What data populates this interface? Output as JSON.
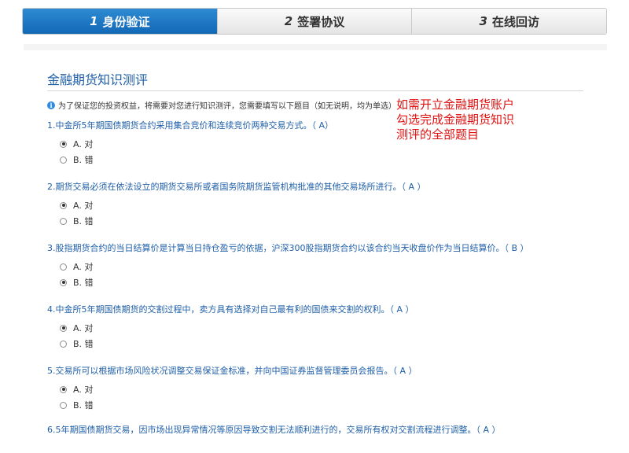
{
  "steps": [
    {
      "num": "1",
      "label": "身份验证",
      "active": true
    },
    {
      "num": "2",
      "label": "签署协议",
      "active": false
    },
    {
      "num": "3",
      "label": "在线回访",
      "active": false
    }
  ],
  "section_title": "金融期货知识测评",
  "notice": "为了保证您的投资权益，将需要对您进行知识测评，您需要填写以下题目（如无说明，均为单选）",
  "callout": [
    "如需开立金融期货账户",
    "勾选完成金融期货知识",
    "测评的全部题目"
  ],
  "questions": [
    {
      "text": "1.中金所5年期国债期货合约采用集合竞价和连续竞价两种交易方式。（ A）",
      "options": [
        {
          "label": "A. 对",
          "checked": true
        },
        {
          "label": "B. 错",
          "checked": false
        }
      ]
    },
    {
      "text": "2.期货交易必须在依法设立的期货交易所或者国务院期货监管机构批准的其他交易场所进行。（ A ）",
      "options": [
        {
          "label": "A. 对",
          "checked": true
        },
        {
          "label": "B. 错",
          "checked": false
        }
      ]
    },
    {
      "text": "3.股指期货合约的当日结算价是计算当日持仓盈亏的依据，沪深300股指期货合约以该合约当天收盘价作为当日结算价。（ B ）",
      "options": [
        {
          "label": "A. 对",
          "checked": false
        },
        {
          "label": "B. 错",
          "checked": true
        }
      ]
    },
    {
      "text": "4.中金所5年期国债期货的交割过程中，卖方具有选择对自己最有利的国债来交割的权利。（ A ）",
      "options": [
        {
          "label": "A. 对",
          "checked": true
        },
        {
          "label": "B. 错",
          "checked": false
        }
      ]
    },
    {
      "text": "5.交易所可以根据市场风险状况调整交易保证金标准，并向中国证券监督管理委员会报告。（ A ）",
      "options": [
        {
          "label": "A. 对",
          "checked": true
        },
        {
          "label": "B. 错",
          "checked": false
        }
      ]
    },
    {
      "text": "6.5年期国债期货交易，因市场出现异常情况等原因导致交割无法顺利进行的，交易所有权对交割流程进行调整。（ A ）",
      "options": []
    }
  ]
}
